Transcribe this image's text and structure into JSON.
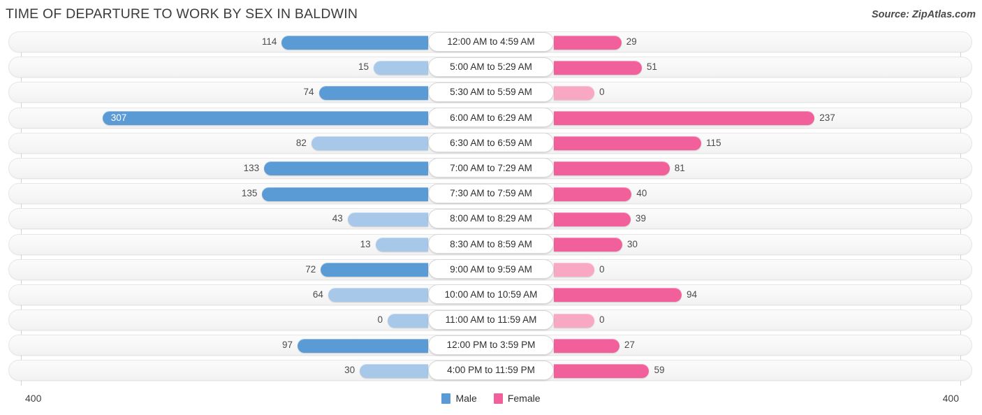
{
  "header": {
    "title": "TIME OF DEPARTURE TO WORK BY SEX IN BALDWIN",
    "source": "Source: ZipAtlas.com"
  },
  "legend": {
    "male_label": "Male",
    "female_label": "Female",
    "male_color": "#5b9bd5",
    "female_color": "#f2609b"
  },
  "axis": {
    "left_max": "400",
    "right_max": "400"
  },
  "colors": {
    "male_dark": "#5b9bd5",
    "male_light": "#a8c8ea",
    "female_dark": "#f2609b",
    "female_light": "#f9a8c4",
    "track": "#f7f7f7",
    "gridline": "#d3d3d3",
    "title": "#3c3c3c"
  },
  "chart_data": {
    "type": "bar",
    "title": "TIME OF DEPARTURE TO WORK BY SEX IN BALDWIN",
    "subtitle": "",
    "xlabel": "",
    "ylabel": "",
    "orientation": "horizontal-diverging",
    "axis_max": 400,
    "grid": true,
    "legend_position": "bottom-center",
    "categories": [
      "12:00 AM to 4:59 AM",
      "5:00 AM to 5:29 AM",
      "5:30 AM to 5:59 AM",
      "6:00 AM to 6:29 AM",
      "6:30 AM to 6:59 AM",
      "7:00 AM to 7:29 AM",
      "7:30 AM to 7:59 AM",
      "8:00 AM to 8:29 AM",
      "8:30 AM to 8:59 AM",
      "9:00 AM to 9:59 AM",
      "10:00 AM to 10:59 AM",
      "11:00 AM to 11:59 AM",
      "12:00 PM to 3:59 PM",
      "4:00 PM to 11:59 PM"
    ],
    "series": [
      {
        "name": "Male",
        "color": "#5b9bd5",
        "direction": "left",
        "values": [
          114,
          15,
          74,
          307,
          82,
          133,
          135,
          43,
          13,
          72,
          64,
          0,
          97,
          30
        ]
      },
      {
        "name": "Female",
        "color": "#f2609b",
        "direction": "right",
        "values": [
          29,
          51,
          0,
          237,
          115,
          81,
          40,
          39,
          30,
          0,
          94,
          0,
          27,
          59
        ]
      }
    ]
  },
  "rows": [
    {
      "category": "12:00 AM to 4:59 AM",
      "male": 114,
      "female": 29,
      "male_label": "114",
      "female_label": "29",
      "male_inside": false,
      "female_inside": false,
      "male_tone": "dark",
      "female_tone": "dark"
    },
    {
      "category": "5:00 AM to 5:29 AM",
      "male": 15,
      "female": 51,
      "male_label": "15",
      "female_label": "51",
      "male_inside": false,
      "female_inside": false,
      "male_tone": "light",
      "female_tone": "dark"
    },
    {
      "category": "5:30 AM to 5:59 AM",
      "male": 74,
      "female": 0,
      "male_label": "74",
      "female_label": "0",
      "male_inside": false,
      "female_inside": false,
      "male_tone": "dark",
      "female_tone": "light"
    },
    {
      "category": "6:00 AM to 6:29 AM",
      "male": 307,
      "female": 237,
      "male_label": "307",
      "female_label": "237",
      "male_inside": true,
      "female_inside": false,
      "male_tone": "dark",
      "female_tone": "dark"
    },
    {
      "category": "6:30 AM to 6:59 AM",
      "male": 82,
      "female": 115,
      "male_label": "82",
      "female_label": "115",
      "male_inside": false,
      "female_inside": false,
      "male_tone": "light",
      "female_tone": "dark"
    },
    {
      "category": "7:00 AM to 7:29 AM",
      "male": 133,
      "female": 81,
      "male_label": "133",
      "female_label": "81",
      "male_inside": false,
      "female_inside": false,
      "male_tone": "dark",
      "female_tone": "dark"
    },
    {
      "category": "7:30 AM to 7:59 AM",
      "male": 135,
      "female": 40,
      "male_label": "135",
      "female_label": "40",
      "male_inside": false,
      "female_inside": false,
      "male_tone": "dark",
      "female_tone": "dark"
    },
    {
      "category": "8:00 AM to 8:29 AM",
      "male": 43,
      "female": 39,
      "male_label": "43",
      "female_label": "39",
      "male_inside": false,
      "female_inside": false,
      "male_tone": "light",
      "female_tone": "dark"
    },
    {
      "category": "8:30 AM to 8:59 AM",
      "male": 13,
      "female": 30,
      "male_label": "13",
      "female_label": "30",
      "male_inside": false,
      "female_inside": false,
      "male_tone": "light",
      "female_tone": "dark"
    },
    {
      "category": "9:00 AM to 9:59 AM",
      "male": 72,
      "female": 0,
      "male_label": "72",
      "female_label": "0",
      "male_inside": false,
      "female_inside": false,
      "male_tone": "dark",
      "female_tone": "light"
    },
    {
      "category": "10:00 AM to 10:59 AM",
      "male": 64,
      "female": 94,
      "male_label": "64",
      "female_label": "94",
      "male_inside": false,
      "female_inside": false,
      "male_tone": "light",
      "female_tone": "dark"
    },
    {
      "category": "11:00 AM to 11:59 AM",
      "male": 0,
      "female": 0,
      "male_label": "0",
      "female_label": "0",
      "male_inside": false,
      "female_inside": false,
      "male_tone": "light",
      "female_tone": "light"
    },
    {
      "category": "12:00 PM to 3:59 PM",
      "male": 97,
      "female": 27,
      "male_label": "97",
      "female_label": "27",
      "male_inside": false,
      "female_inside": false,
      "male_tone": "dark",
      "female_tone": "dark"
    },
    {
      "category": "4:00 PM to 11:59 PM",
      "male": 30,
      "female": 59,
      "male_label": "30",
      "female_label": "59",
      "male_inside": false,
      "female_inside": false,
      "male_tone": "light",
      "female_tone": "dark"
    }
  ]
}
